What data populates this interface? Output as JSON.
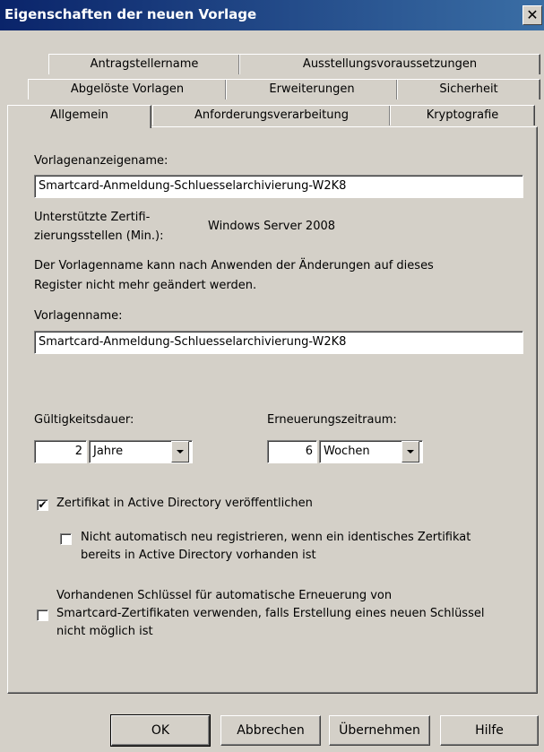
{
  "window": {
    "title": "Eigenschaften der neuen Vorlage",
    "close_glyph": "✕"
  },
  "tabs": {
    "row1": [
      "Antragstellername",
      "Ausstellungsvoraussetzungen"
    ],
    "row2": [
      "Abgelöste Vorlagen",
      "Erweiterungen",
      "Sicherheit"
    ],
    "row3": [
      "Allgemein",
      "Anforderungsverarbeitung",
      "Kryptografie"
    ],
    "active": "Allgemein"
  },
  "general": {
    "display_name_label": "Vorlagenanzeigename:",
    "display_name_value": "Smartcard-Anmeldung-Schluesselarchivierung-W2K8",
    "supported_ca_label_1": "Unterstützte Zertifi-",
    "supported_ca_label_2": "zierungsstellen (Min.):",
    "supported_ca_value": "Windows Server 2008",
    "note_line1": "Der Vorlagenname kann nach Anwenden der Änderungen auf dieses",
    "note_line2": "Register nicht mehr geändert werden.",
    "template_name_label": "Vorlagenname:",
    "template_name_value": "Smartcard-Anmeldung-Schluesselarchivierung-W2K8",
    "validity_label": "Gültigkeitsdauer:",
    "validity_number": "2",
    "validity_unit": "Jahre",
    "renewal_label": "Erneuerungszeitraum:",
    "renewal_number": "6",
    "renewal_unit": "Wochen",
    "publish_ad_label": "Zertifikat in Active Directory veröffentlichen",
    "publish_ad_checked": true,
    "no_reenroll_line1": "Nicht automatisch neu registrieren, wenn ein identisches Zertifikat",
    "no_reenroll_line2": "bereits in Active Directory vorhanden ist",
    "no_reenroll_checked": false,
    "reuse_key_line1": "Vorhandenen Schlüssel für automatische Erneuerung von",
    "reuse_key_line2": "Smartcard-Zertifikaten verwenden, falls Erstellung eines neuen Schlüssel",
    "reuse_key_line3": "nicht möglich ist",
    "reuse_key_checked": false,
    "check_glyph": "✔"
  },
  "buttons": {
    "ok": "OK",
    "cancel": "Abbrechen",
    "apply": "Übernehmen",
    "help": "Hilfe"
  }
}
